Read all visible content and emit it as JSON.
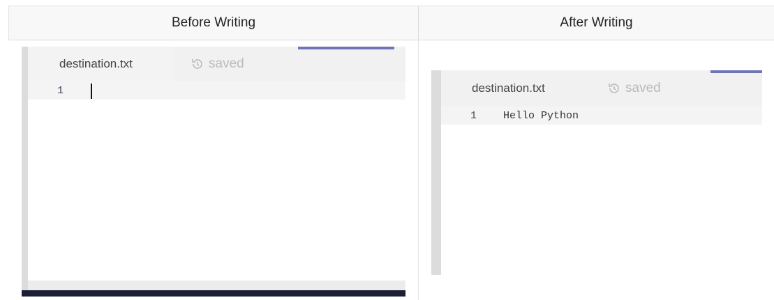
{
  "columns": {
    "before_title": "Before Writing",
    "after_title": "After Writing"
  },
  "before_editor": {
    "tab_label": "destination.txt",
    "saved_label": "saved",
    "line_number": "1",
    "code": ""
  },
  "after_editor": {
    "tab_label": "destination.txt",
    "saved_label": "saved",
    "line_number": "1",
    "code": "Hello Python"
  },
  "colors": {
    "accent": "#6f75b5",
    "bottom_bar": "#1b1f35"
  }
}
